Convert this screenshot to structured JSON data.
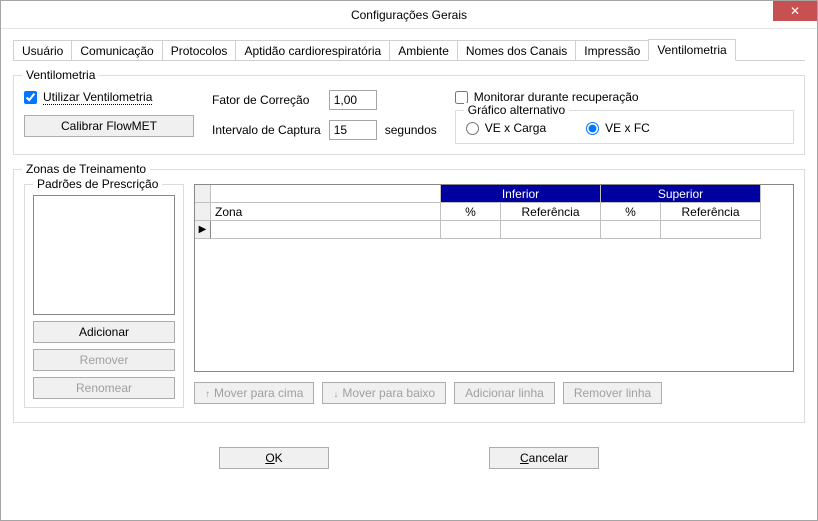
{
  "window": {
    "title": "Configurações Gerais"
  },
  "tabs": {
    "t0": "Usuário",
    "t1": "Comunicação",
    "t2": "Protocolos",
    "t3": "Aptidão cardiorespiratória",
    "t4": "Ambiente",
    "t5": "Nomes dos Canais",
    "t6": "Impressão",
    "t7": "Ventilometria"
  },
  "vent": {
    "group": "Ventilometria",
    "use_label": "Utilizar Ventilometria",
    "calibrate": "Calibrar FlowMET",
    "factor_label": "Fator de Correção",
    "factor_value": "1,00",
    "interval_label": "Intervalo de Captura",
    "interval_value": "15",
    "seconds": "segundos",
    "monitor_label": "Monitorar durante recuperação",
    "alt_group": "Gráfico alternativo",
    "alt_opt1": "VE x Carga",
    "alt_opt2": "VE x FC"
  },
  "zonas": {
    "group": "Zonas de Treinamento",
    "padroes_group": "Padrões de Prescrição",
    "add": "Adicionar",
    "remove": "Remover",
    "rename": "Renomear",
    "col_zona": "Zona",
    "col_pct": "%",
    "col_ref": "Referência",
    "hdr_inf": "Inferior",
    "hdr_sup": "Superior",
    "move_up": "Mover para cima",
    "move_down": "Mover para baixo",
    "add_row": "Adicionar linha",
    "rm_row": "Remover linha"
  },
  "footer": {
    "ok": "OK",
    "cancel": "Cancelar"
  }
}
